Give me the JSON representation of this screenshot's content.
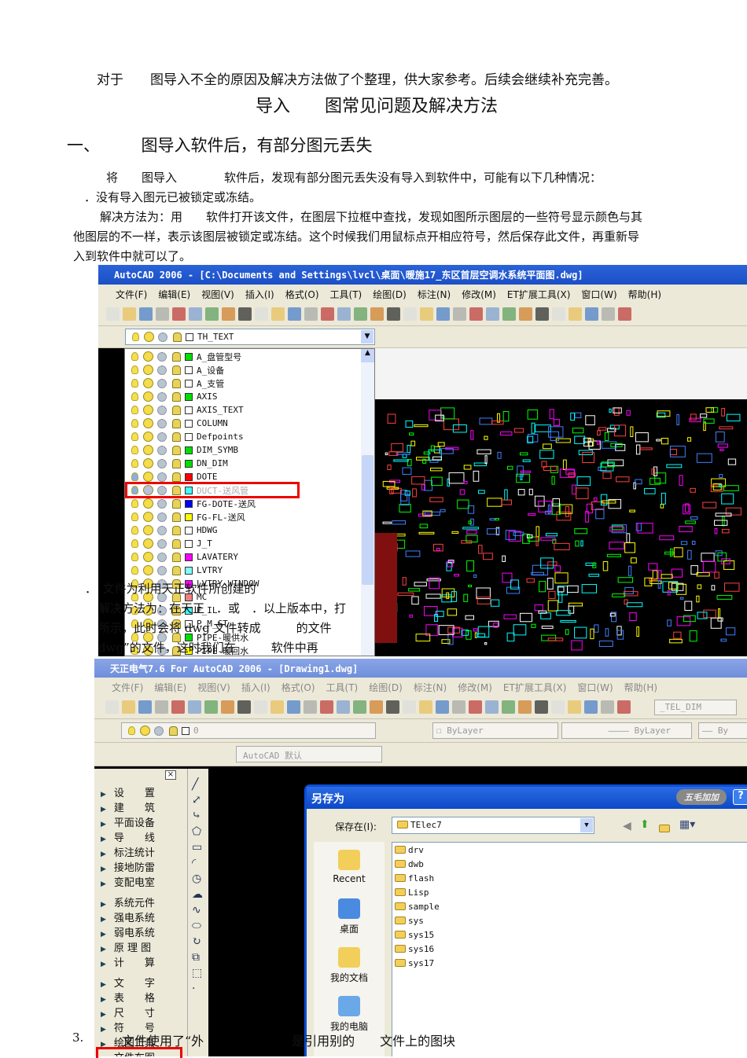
{
  "doc": {
    "intro": "对于　　图导入不全的原因及解决方法做了个整理，供大家参考。后续会继续补充完善。",
    "title": "导入　　图常见问题及解决方法",
    "heading1": "一、　　　图导入软件后，有部分图元丢失",
    "p1": "将　　图导入　　　　软件后，发现有部分图元丢失没有导入到软件中，可能有以下几种情况：",
    "p2": "．没有导入图元已被锁定或冻结。",
    "p3a": "解决方法为：用　　软件打开该文件，在图层下拉框中查找，发现如图所示图层的一些符号显示颜色与其",
    "p3b": "他图层的不一样，表示该图层被锁定或冻结。这个时候我们用鼠标点开相应符号，然后保存此文件，再重新导",
    "p3c": "入到软件中就可以了。",
    "o1": "．　文件为利用天正软件所创建的",
    "o2": "解决方法为：在天正　．或　．以上版本中，打",
    "o3": "所示，此时会将 dwg 文件转成　　　的文件",
    "o4": "dwg”的文件，这时我们在　　　软件中再",
    "p4num": "3.",
    "p4": "文件使用了“外　　　　　　　是引用别的　　文件上的图块"
  },
  "shot1": {
    "title": "AutoCAD 2006 - [C:\\Documents and Settings\\lvcl\\桌面\\暖施17_东区首层空调水系统平面图.dwg]",
    "menu": [
      "文件(F)",
      "编辑(E)",
      "视图(V)",
      "插入(I)",
      "格式(O)",
      "工具(T)",
      "绘图(D)",
      "标注(N)",
      "修改(M)",
      "ET扩展工具(X)",
      "窗口(W)",
      "帮助(H)"
    ],
    "current_layer": "TH_TEXT",
    "layers": [
      {
        "name": "A_盘管型号",
        "color": "#00e000"
      },
      {
        "name": "A_设备",
        "color": "#ffffff"
      },
      {
        "name": "A_支管",
        "color": "#ffffff"
      },
      {
        "name": "AXIS",
        "color": "#00e000"
      },
      {
        "name": "AXIS_TEXT",
        "color": "#ffffff"
      },
      {
        "name": "COLUMN",
        "color": "#ffffff"
      },
      {
        "name": "Defpoints",
        "color": "#ffffff"
      },
      {
        "name": "DIM_SYMB",
        "color": "#00e000"
      },
      {
        "name": "DN_DIM",
        "color": "#00e000"
      },
      {
        "name": "DOTE",
        "color": "#ff0000"
      },
      {
        "name": "DUCT-送风管",
        "color": "#40ffff",
        "frozen": true
      },
      {
        "name": "FG-DOTE-送风",
        "color": "#0000ff"
      },
      {
        "name": "FG-FL-送风",
        "color": "#ffff00"
      },
      {
        "name": "HDWG",
        "color": "#ffffff"
      },
      {
        "name": "J_T",
        "color": "#ffffff"
      },
      {
        "name": "LAVATERY",
        "color": "#ff00ff"
      },
      {
        "name": "LVTRY",
        "color": "#80ffff"
      },
      {
        "name": "LVTRY-WINDOW",
        "color": "#ff00ff"
      },
      {
        "name": "MC",
        "color": "#f08080"
      },
      {
        "name": "E_IL",
        "color": "#40ffff"
      },
      {
        "name": "P_M_GT",
        "color": "#ffffff"
      },
      {
        "name": "PIPE-暖供水",
        "color": "#00e000"
      },
      {
        "name": "PIPE-暖回水",
        "color": "#ffff00"
      }
    ]
  },
  "shot2": {
    "title": "天正电气7.6 For AutoCAD 2006 - [Drawing1.dwg]",
    "menu": [
      "文件(F)",
      "编辑(E)",
      "视图(V)",
      "插入(I)",
      "格式(O)",
      "工具(T)",
      "绘图(D)",
      "标注(N)",
      "修改(M)",
      "ET扩展工具(X)",
      "窗口(W)",
      "帮助(H)"
    ],
    "textstyle": "_TEL_DIM",
    "layer": "0",
    "color": "ByLayer",
    "linetype": "ByLayer",
    "linetype2": "By",
    "workspace": "AutoCAD 默认",
    "side": [
      "设　　置",
      "建　　筑",
      "平面设备",
      "导　　线",
      "标注统计",
      "接地防雷",
      "变配电室",
      "系统元件",
      "强电系统",
      "弱电系统",
      "原 理 图",
      "计　　算",
      "文　　字",
      "表　　格",
      "尺　　寸",
      "符　　号",
      "绘图工具",
      "文件布图"
    ],
    "close": "×",
    "dialog": {
      "title": "另存为",
      "badge": "五毛加加",
      "help": "?",
      "savein_label": "保存在(I):",
      "savein": "TElec7",
      "places": [
        "Recent",
        "桌面",
        "我的文档",
        "我的电脑"
      ],
      "folders": [
        "drv",
        "dwb",
        "flash",
        "Lisp",
        "sample",
        "sys",
        "sys15",
        "sys16",
        "sys17"
      ]
    }
  }
}
